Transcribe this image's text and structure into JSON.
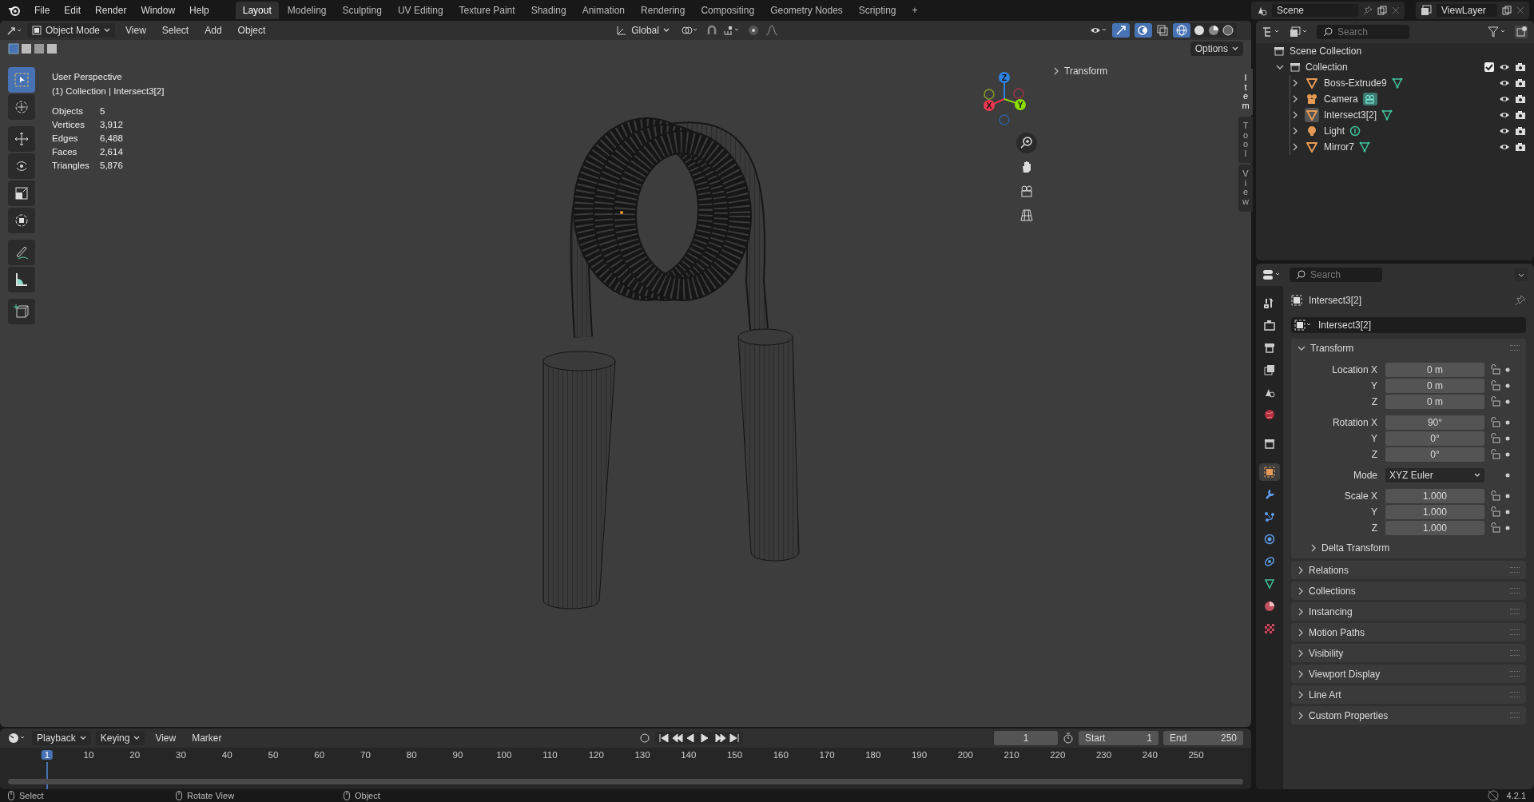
{
  "menu": [
    "File",
    "Edit",
    "Render",
    "Window",
    "Help"
  ],
  "workspaces": [
    {
      "label": "Layout",
      "selected": true
    },
    {
      "label": "Modeling",
      "selected": false
    },
    {
      "label": "Sculpting",
      "selected": false
    },
    {
      "label": "UV Editing",
      "selected": false
    },
    {
      "label": "Texture Paint",
      "selected": false
    },
    {
      "label": "Shading",
      "selected": false
    },
    {
      "label": "Animation",
      "selected": false
    },
    {
      "label": "Rendering",
      "selected": false
    },
    {
      "label": "Compositing",
      "selected": false
    },
    {
      "label": "Geometry Nodes",
      "selected": false
    },
    {
      "label": "Scripting",
      "selected": false
    }
  ],
  "add_workspace": "+",
  "scene": "Scene",
  "view_layer": "ViewLayer",
  "viewport_header": {
    "mode": "Object Mode",
    "menus": [
      "View",
      "Select",
      "Add",
      "Object"
    ],
    "orientation": "Global",
    "options": "Options"
  },
  "tools": [
    {
      "kind": "select",
      "selected": true
    },
    {
      "kind": "cursor",
      "selected": false
    },
    {
      "kind": "move",
      "selected": false
    },
    {
      "kind": "rotate",
      "selected": false
    },
    {
      "kind": "scale",
      "selected": false
    },
    {
      "kind": "transform",
      "selected": false
    },
    {
      "kind": "annotate",
      "selected": false
    },
    {
      "kind": "measure",
      "selected": false
    },
    {
      "kind": "add_cube",
      "selected": false
    }
  ],
  "overlay": {
    "title": "User Perspective",
    "context": "(1) Collection | Intersect3[2]",
    "stats": [
      {
        "label": "Objects",
        "value": "5"
      },
      {
        "label": "Vertices",
        "value": "3,912"
      },
      {
        "label": "Edges",
        "value": "6,488"
      },
      {
        "label": "Faces",
        "value": "2,614"
      },
      {
        "label": "Triangles",
        "value": "5,876"
      }
    ]
  },
  "gizmo": {
    "x": "X",
    "y": "Y",
    "z": "Z"
  },
  "sidebar": {
    "section": "Transform",
    "tabs": [
      {
        "label": "Item",
        "selected": true
      },
      {
        "label": "Tool",
        "selected": false
      },
      {
        "label": "View",
        "selected": false
      }
    ]
  },
  "outliner": {
    "search_placeholder": "Search",
    "root": "Scene Collection",
    "collection": {
      "label": "Collection",
      "expanded": true,
      "checked": true,
      "children": [
        {
          "label": "Boss-Extrude9",
          "kind": "mesh",
          "selected": false
        },
        {
          "label": "Camera",
          "kind": "camera",
          "selected": false
        },
        {
          "label": "Intersect3[2]",
          "kind": "mesh",
          "selected": true
        },
        {
          "label": "Light",
          "kind": "light",
          "selected": false
        },
        {
          "label": "Mirror7",
          "kind": "mesh",
          "selected": false
        }
      ]
    }
  },
  "properties": {
    "search_placeholder": "Search",
    "tabs": [
      {
        "kind": "tool",
        "selected": false
      },
      {
        "kind": "render",
        "selected": false
      },
      {
        "kind": "output",
        "selected": false
      },
      {
        "kind": "view_layer",
        "selected": false
      },
      {
        "kind": "scene",
        "selected": false
      },
      {
        "kind": "world",
        "selected": false
      },
      {
        "kind": "collection",
        "selected": false
      },
      {
        "kind": "object",
        "selected": true
      },
      {
        "kind": "modifiers",
        "selected": false
      },
      {
        "kind": "particles",
        "selected": false
      },
      {
        "kind": "physics",
        "selected": false
      },
      {
        "kind": "constraints",
        "selected": false
      },
      {
        "kind": "data",
        "selected": false
      },
      {
        "kind": "material",
        "selected": false
      },
      {
        "kind": "texture",
        "selected": false
      }
    ],
    "object_name": "Intersect3[2]",
    "name_field": "Intersect3[2]",
    "transform": {
      "title": "Transform",
      "expanded": true,
      "rows": [
        {
          "kind": "number",
          "label": "Location X",
          "value": "0 m"
        },
        {
          "kind": "number",
          "label": "Y",
          "value": "0 m"
        },
        {
          "kind": "number",
          "label": "Z",
          "value": "0 m"
        },
        {
          "kind": "number",
          "label": "Rotation X",
          "value": "90°"
        },
        {
          "kind": "number",
          "label": "Y",
          "value": "0°"
        },
        {
          "kind": "number",
          "label": "Z",
          "value": "0°"
        },
        {
          "kind": "dropdown",
          "label": "Mode",
          "value": "XYZ Euler"
        },
        {
          "kind": "number",
          "label": "Scale X",
          "value": "1.000"
        },
        {
          "kind": "number",
          "label": "Y",
          "value": "1.000"
        },
        {
          "kind": "number",
          "label": "Z",
          "value": "1.000"
        }
      ],
      "subpanel": "Delta Transform"
    },
    "panels": [
      "Relations",
      "Collections",
      "Instancing",
      "Motion Paths",
      "Visibility",
      "Viewport Display",
      "Line Art",
      "Custom Properties"
    ]
  },
  "timeline": {
    "menus": [
      "Playback",
      "Keying",
      "View",
      "Marker"
    ],
    "current_frame": "1",
    "start_label": "Start",
    "start": "1",
    "end_label": "End",
    "end": "250",
    "ruler": [
      "1",
      "10",
      "20",
      "30",
      "40",
      "50",
      "60",
      "70",
      "80",
      "90",
      "100",
      "110",
      "120",
      "130",
      "140",
      "150",
      "160",
      "170",
      "180",
      "190",
      "200",
      "210",
      "220",
      "230",
      "240",
      "250"
    ]
  },
  "status_bar": {
    "hints": [
      "Select",
      "Rotate View",
      "Object"
    ],
    "version": "4.2.1"
  }
}
